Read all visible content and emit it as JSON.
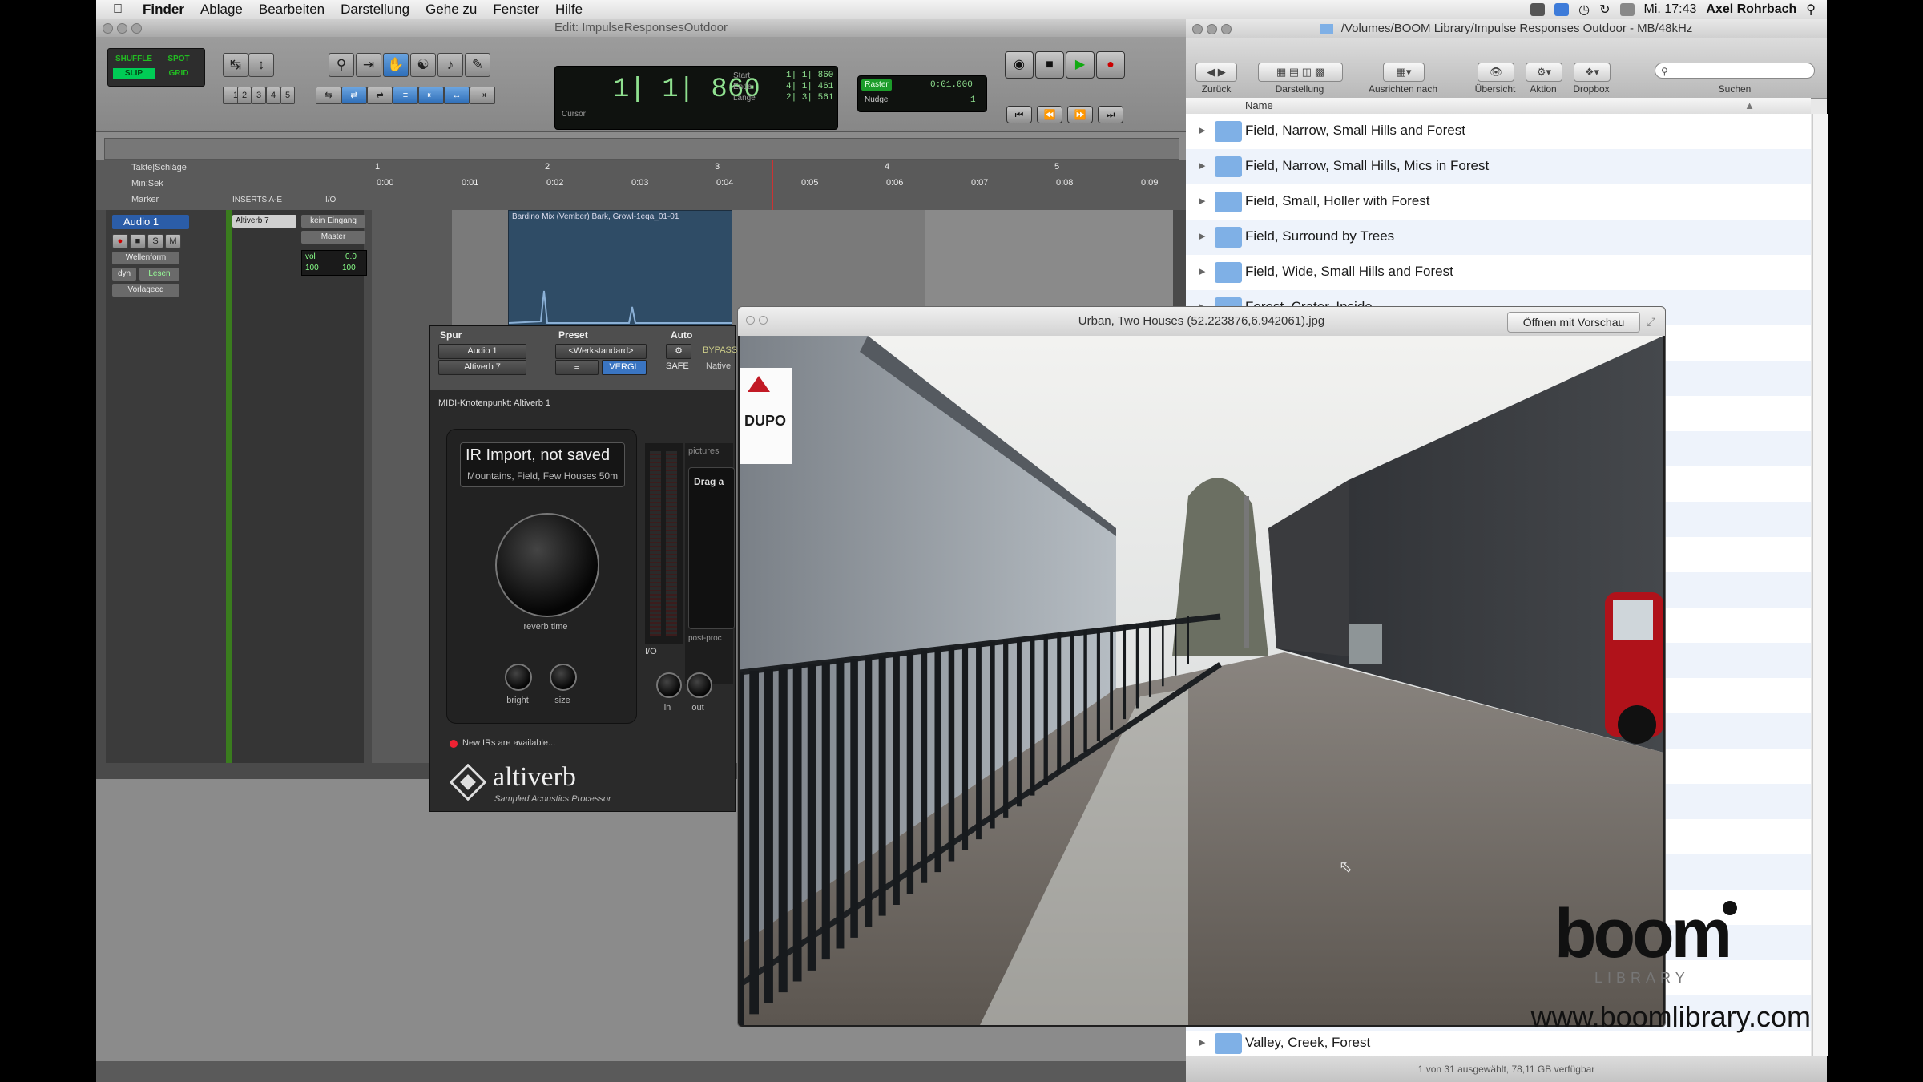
{
  "menubar": {
    "app": "Finder",
    "items": [
      "Ablage",
      "Bearbeiten",
      "Darstellung",
      "Gehe zu",
      "Fenster",
      "Hilfe"
    ],
    "clock": "Mi. 17:43",
    "user": "Axel Rohrbach"
  },
  "protools": {
    "window_title": "Edit: ImpulseResponsesOutdoor",
    "modes": [
      "SHUFFLE",
      "SPOT",
      "SLIP",
      "GRID"
    ],
    "number_buttons": [
      "1",
      "2",
      "3",
      "4",
      "5"
    ],
    "counter": {
      "main": "1| 1| 860",
      "cursor_label": "Cursor",
      "start_label": "Start",
      "end_label": "Ende",
      "length_label": "Länge",
      "start": "1| 1| 860",
      "end": "4| 1| 461",
      "length": "2| 3| 561"
    },
    "grid": {
      "label": "Raster",
      "value": "0:01.000",
      "nudge_label": "Nudge",
      "nudge_value": "1"
    },
    "rulers": {
      "bars_label": "Takte|Schläge",
      "minsec_label": "Min:Sek",
      "marker_label": "Marker",
      "bars": [
        "1",
        "2",
        "3",
        "4",
        "5"
      ],
      "times": [
        "0:00",
        "0:01",
        "0:02",
        "0:03",
        "0:04",
        "0:05",
        "0:06",
        "0:07",
        "0:08",
        "0:09"
      ]
    },
    "track": {
      "name": "Audio 1",
      "view": "Wellenform",
      "dyn": "dyn",
      "mode": "Lesen",
      "playlist": "Vorlageed",
      "inserts_header": "INSERTS A-E",
      "io_header": "I/O",
      "insert": "Altiverb 7",
      "input": "kein Eingang",
      "output": "Master",
      "vol_label": "vol",
      "vol": "0.0",
      "pan_left": "100",
      "pan_right": "100"
    },
    "clip_name": "Bardino Mix (Vember) Bark, Growl-1eqa_01-01"
  },
  "altiverb": {
    "header": {
      "spur": "Spur",
      "preset": "Preset",
      "auto": "Auto",
      "track": "Audio 1",
      "insert": "Altiverb 7",
      "preset_value": "<Werkstandard>",
      "compare": "VERGL",
      "safe": "SAFE",
      "bypass": "BYPASS",
      "native": "Native",
      "midi": "MIDI-Knotenpunkt: Altiverb 1"
    },
    "ir_title": "IR Import, not saved",
    "ir_sub": "Mountains, Field, Few Houses 50m",
    "knobs": {
      "reverb": "reverb time",
      "bright": "bright",
      "size": "size",
      "in": "in",
      "out": "out"
    },
    "io_label": "I/O",
    "pictures_label": "pictures",
    "drag_label": "Drag a",
    "post_label": "post-proc",
    "news": "New IRs are available...",
    "brand": "altiverb",
    "brand_sub": "Sampled Acoustics Processor"
  },
  "finder": {
    "title": "/Volumes/BOOM Library/Impulse Responses Outdoor - MB/48kHz",
    "toolbar": {
      "back": "Zurück",
      "view": "Darstellung",
      "arrange": "Ausrichten nach",
      "overview": "Übersicht",
      "action": "Aktion",
      "dropbox": "Dropbox",
      "search": "Suchen"
    },
    "column": "Name",
    "rows": [
      "Field, Narrow, Small Hills and Forest",
      "Field, Narrow, Small Hills, Mics in Forest",
      "Field, Small, Holler with Forest",
      "Field, Surround by Trees",
      "Field, Wide, Small Hills and Forest",
      "Forest, Crater, Inside"
    ],
    "last_row": "Valley, Creek, Forest",
    "status": "1 von 31 ausgewählt, 78,11 GB verfügbar",
    "folder_color": "#7fb0e6"
  },
  "quicklook": {
    "title": "Urban, Two Houses (52.223876,6.942061).jpg",
    "open_button": "Öffnen mit Vorschau",
    "sign_text": "DUPO"
  },
  "watermark": {
    "logo": "boom",
    "sub": "LIBRARY",
    "url": "www.boomlibrary.com"
  }
}
